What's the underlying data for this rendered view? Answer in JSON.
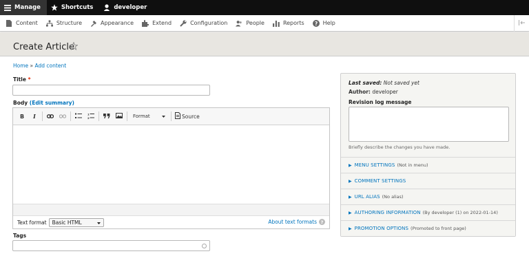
{
  "toolbar": {
    "manage": "Manage",
    "shortcuts": "Shortcuts",
    "user": "developer"
  },
  "tray": {
    "items": [
      {
        "label": "Content",
        "icon": "content-icon"
      },
      {
        "label": "Structure",
        "icon": "structure-icon"
      },
      {
        "label": "Appearance",
        "icon": "appearance-icon"
      },
      {
        "label": "Extend",
        "icon": "extend-icon"
      },
      {
        "label": "Configuration",
        "icon": "configuration-icon"
      },
      {
        "label": "People",
        "icon": "people-icon"
      },
      {
        "label": "Reports",
        "icon": "reports-icon"
      },
      {
        "label": "Help",
        "icon": "help-icon"
      }
    ]
  },
  "page": {
    "title": "Create Article"
  },
  "breadcrumb": {
    "home": "Home",
    "separator": "»",
    "current": "Add content"
  },
  "form": {
    "title_label": "Title",
    "required_mark": "*",
    "title_value": "",
    "body_label": "Body",
    "edit_summary": "(Edit summary)",
    "editor": {
      "bold": "B",
      "italic": "I",
      "format_label": "Format",
      "source_label": "Source"
    },
    "text_format_label": "Text format",
    "text_format_value": "Basic HTML",
    "about_text_formats": "About text formats",
    "tags_label": "Tags",
    "tags_value": ""
  },
  "sidebar": {
    "last_saved_label": "Last saved:",
    "last_saved_value": "Not saved yet",
    "author_label": "Author:",
    "author_value": "developer",
    "revision_label": "Revision log message",
    "revision_value": "",
    "revision_desc": "Briefly describe the changes you have made.",
    "sections": [
      {
        "title": "MENU SETTINGS",
        "note": "(Not in menu)"
      },
      {
        "title": "COMMENT SETTINGS",
        "note": ""
      },
      {
        "title": "URL ALIAS",
        "note": "(No alias)"
      },
      {
        "title": "AUTHORING INFORMATION",
        "note": "(By developer (1) on 2022-01-14)"
      },
      {
        "title": "PROMOTION OPTIONS",
        "note": "(Promoted to front page)"
      }
    ]
  },
  "colors": {
    "link": "#0074bd",
    "toolbar_bg": "#0f0f0f",
    "title_bg": "#e8e6e1",
    "required": "#e62600"
  }
}
